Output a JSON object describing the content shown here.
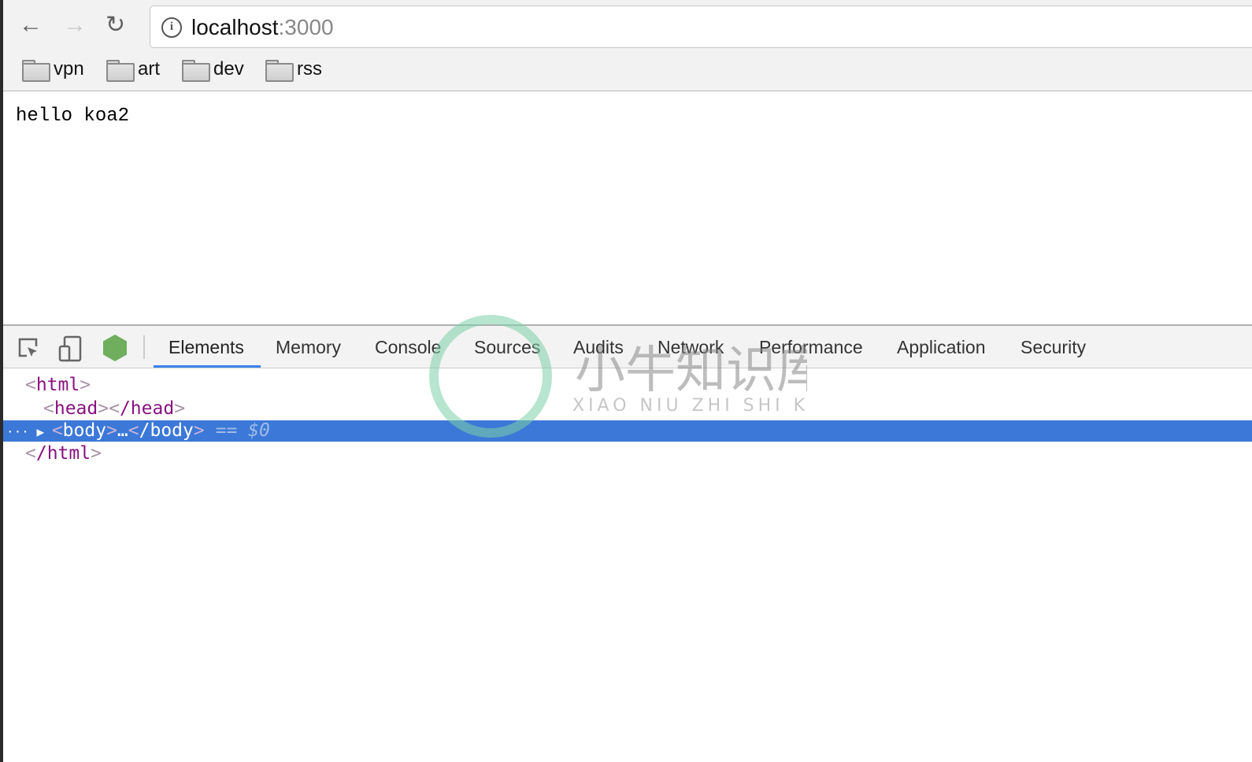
{
  "browser": {
    "url_host": "localhost",
    "url_port": ":3000",
    "bookmarks": [
      {
        "label": "vpn"
      },
      {
        "label": "art"
      },
      {
        "label": "dev"
      },
      {
        "label": "rss"
      }
    ]
  },
  "page": {
    "text": "hello koa2"
  },
  "devtools": {
    "tabs": [
      {
        "label": "Elements"
      },
      {
        "label": "Memory"
      },
      {
        "label": "Console"
      },
      {
        "label": "Sources"
      },
      {
        "label": "Audits"
      },
      {
        "label": "Network"
      },
      {
        "label": "Performance"
      },
      {
        "label": "Application"
      },
      {
        "label": "Security"
      }
    ],
    "active_tab": "Elements",
    "dom": {
      "html_open": "html",
      "head_open": "head",
      "head_close": "/head",
      "body_open": "body",
      "ellipsis": "…",
      "body_close": "/body",
      "eq": " == $0",
      "html_close": "/html",
      "dots": "···"
    },
    "accent": "#3b82f0",
    "selection_color": "#3b78d8"
  },
  "watermark": {
    "cn": "小牛知识库",
    "pinyin": "XIAO NIU ZHI SHI KU"
  }
}
